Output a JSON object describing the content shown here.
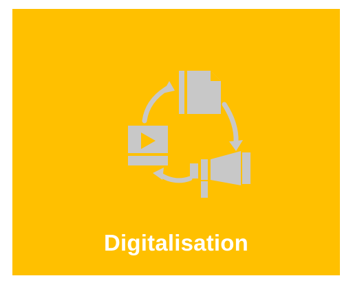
{
  "tile": {
    "label": "Digitalisation",
    "background_color": "#FFC000",
    "label_color": "#FFFFFF",
    "icon_color": "#C8C8C8"
  },
  "icons": [
    "document-icon",
    "megaphone-icon",
    "video-play-icon",
    "cycle-arrows-icon"
  ]
}
